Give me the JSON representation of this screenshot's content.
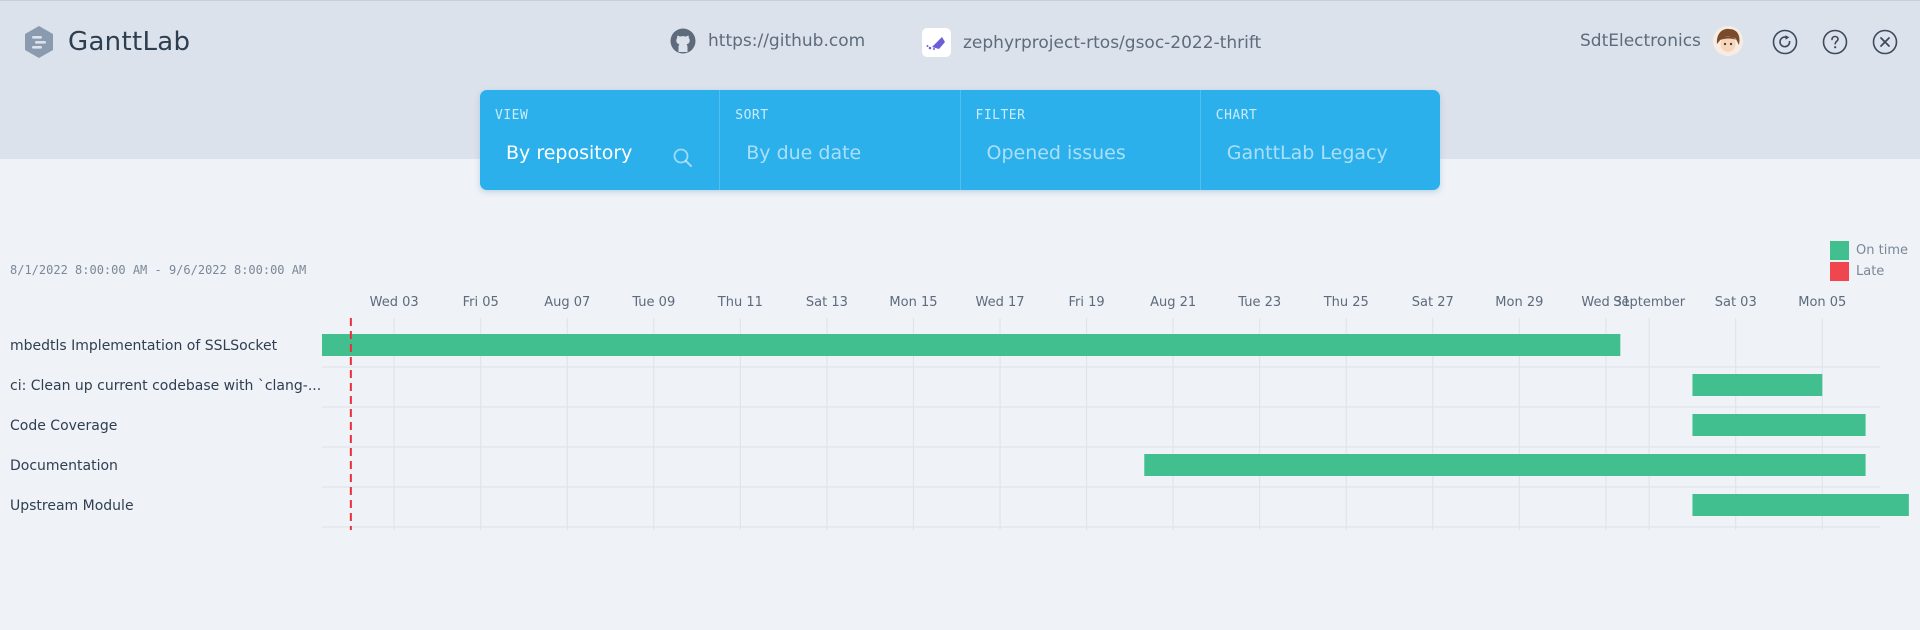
{
  "app": {
    "name": "GanttLab",
    "source_url": "https://github.com",
    "project": "zephyrproject-rtos/gsoc-2022-thrift",
    "user": "SdtElectronics"
  },
  "icons": {
    "logo": "ganttlab-logo-icon",
    "source": "github-icon",
    "project": "project-avatar-icon",
    "user": "user-avatar",
    "refresh": "refresh-icon",
    "help": "help-icon",
    "close": "close-icon",
    "search": "search-icon"
  },
  "panel": {
    "view": {
      "label": "VIEW",
      "value": "By repository"
    },
    "sort": {
      "label": "SORT",
      "value": "By due date"
    },
    "filter": {
      "label": "FILTER",
      "value": "Opened issues"
    },
    "chart": {
      "label": "CHART",
      "value": "GanttLab Legacy"
    }
  },
  "colors": {
    "on_time": "#41bf8f",
    "late": "#f0474f",
    "today_marker": "#e8303a",
    "panel": "#2bb0ec"
  },
  "chart_data": {
    "type": "gantt",
    "range_label": "8/1/2022 8:00:00 AM - 9/6/2022 8:00:00 AM",
    "range": [
      "2022-08-01T08:00",
      "2022-09-06T08:00"
    ],
    "today": "2022-08-02",
    "ticks": [
      {
        "date": "2022-08-03",
        "label": "Wed 03"
      },
      {
        "date": "2022-08-05",
        "label": "Fri 05"
      },
      {
        "date": "2022-08-07",
        "label": "Aug 07"
      },
      {
        "date": "2022-08-09",
        "label": "Tue 09"
      },
      {
        "date": "2022-08-11",
        "label": "Thu 11"
      },
      {
        "date": "2022-08-13",
        "label": "Sat 13"
      },
      {
        "date": "2022-08-15",
        "label": "Mon 15"
      },
      {
        "date": "2022-08-17",
        "label": "Wed 17"
      },
      {
        "date": "2022-08-19",
        "label": "Fri 19"
      },
      {
        "date": "2022-08-21",
        "label": "Aug 21"
      },
      {
        "date": "2022-08-23",
        "label": "Tue 23"
      },
      {
        "date": "2022-08-25",
        "label": "Thu 25"
      },
      {
        "date": "2022-08-27",
        "label": "Sat 27"
      },
      {
        "date": "2022-08-29",
        "label": "Mon 29"
      },
      {
        "date": "2022-08-31",
        "label": "Wed 31"
      },
      {
        "date": "2022-09-01",
        "label": "September"
      },
      {
        "date": "2022-09-03",
        "label": "Sat 03"
      },
      {
        "date": "2022-09-05",
        "label": "Mon 05"
      }
    ],
    "tasks": [
      {
        "name": "mbedtls Implementation of SSLSocket",
        "start": "2022-08-01T08:00",
        "end": "2022-08-31T08:00",
        "status": "On time"
      },
      {
        "name": "ci: Clean up current codebase with `clang-...",
        "start": "2022-09-02T00:00",
        "end": "2022-09-05T00:00",
        "status": "On time"
      },
      {
        "name": "Code Coverage",
        "start": "2022-09-02T00:00",
        "end": "2022-09-06T00:00",
        "status": "On time"
      },
      {
        "name": "Documentation",
        "start": "2022-08-20T08:00",
        "end": "2022-09-06T00:00",
        "status": "On time"
      },
      {
        "name": "Upstream Module",
        "start": "2022-09-02T00:00",
        "end": "2022-09-07T00:00",
        "status": "On time"
      }
    ],
    "legend": [
      {
        "label": "On time",
        "color": "#41bf8f"
      },
      {
        "label": "Late",
        "color": "#f0474f"
      }
    ],
    "legend_position": "top-right",
    "grid": true
  }
}
